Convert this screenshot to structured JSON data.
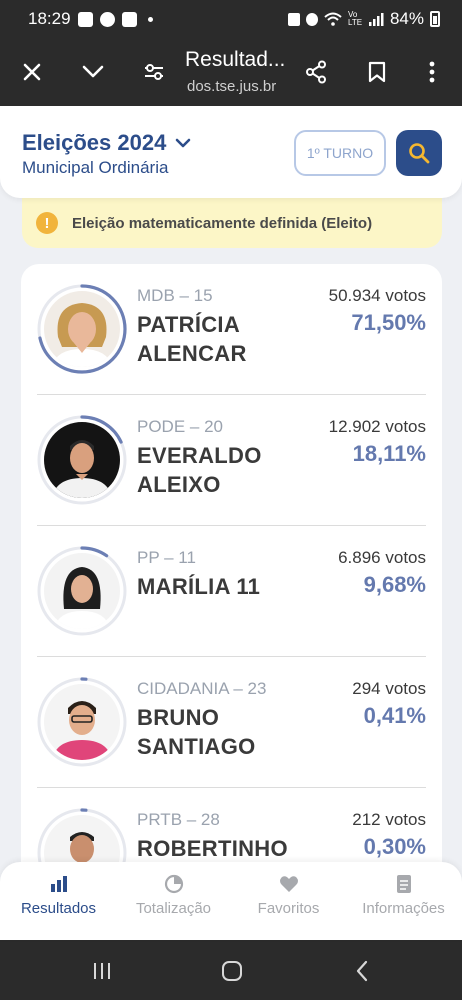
{
  "status_bar": {
    "time": "18:29",
    "battery": "84%",
    "signal_label": "Vo LTE"
  },
  "browser": {
    "title": "Resultad...",
    "url": "dos.tse.jus.br"
  },
  "header": {
    "title": "Eleições 2024",
    "subtitle": "Municipal Ordinária",
    "turno_label": "1º TURNO"
  },
  "alert": {
    "text": "Eleição matematicamente definida (Eleito)"
  },
  "candidates": [
    {
      "party": "MDB – 15",
      "name_line1": "PATRÍCIA",
      "name_line2": "ALENCAR",
      "votes": "50.934 votos",
      "percent": "71,50%",
      "share": 0.715
    },
    {
      "party": "PODE – 20",
      "name_line1": "EVERALDO",
      "name_line2": "ALEIXO",
      "votes": "12.902 votos",
      "percent": "18,11%",
      "share": 0.1811
    },
    {
      "party": "PP – 11",
      "name_line1": "MARÍLIA 11",
      "name_line2": "",
      "votes": "6.896 votos",
      "percent": "9,68%",
      "share": 0.0968
    },
    {
      "party": "CIDADANIA – 23",
      "name_line1": "BRUNO",
      "name_line2": "SANTIAGO",
      "votes": "294 votos",
      "percent": "0,41%",
      "share": 0.0041
    },
    {
      "party": "PRTB – 28",
      "name_line1": "ROBERTINHO",
      "name_line2": "",
      "votes": "212 votos",
      "percent": "0,30%",
      "share": 0.003
    }
  ],
  "bottom_nav": [
    {
      "label": "Resultados",
      "icon": "bar-chart-icon",
      "active": true
    },
    {
      "label": "Totalização",
      "icon": "pie-chart-icon",
      "active": false
    },
    {
      "label": "Favoritos",
      "icon": "heart-icon",
      "active": false
    },
    {
      "label": "Informações",
      "icon": "document-icon",
      "active": false
    }
  ],
  "colors": {
    "primary": "#2c4d8a",
    "percent": "#6479ae",
    "ring": "#6c7fb4",
    "alert_bg": "#fcf6c7",
    "alert_icon": "#f1b43c"
  }
}
